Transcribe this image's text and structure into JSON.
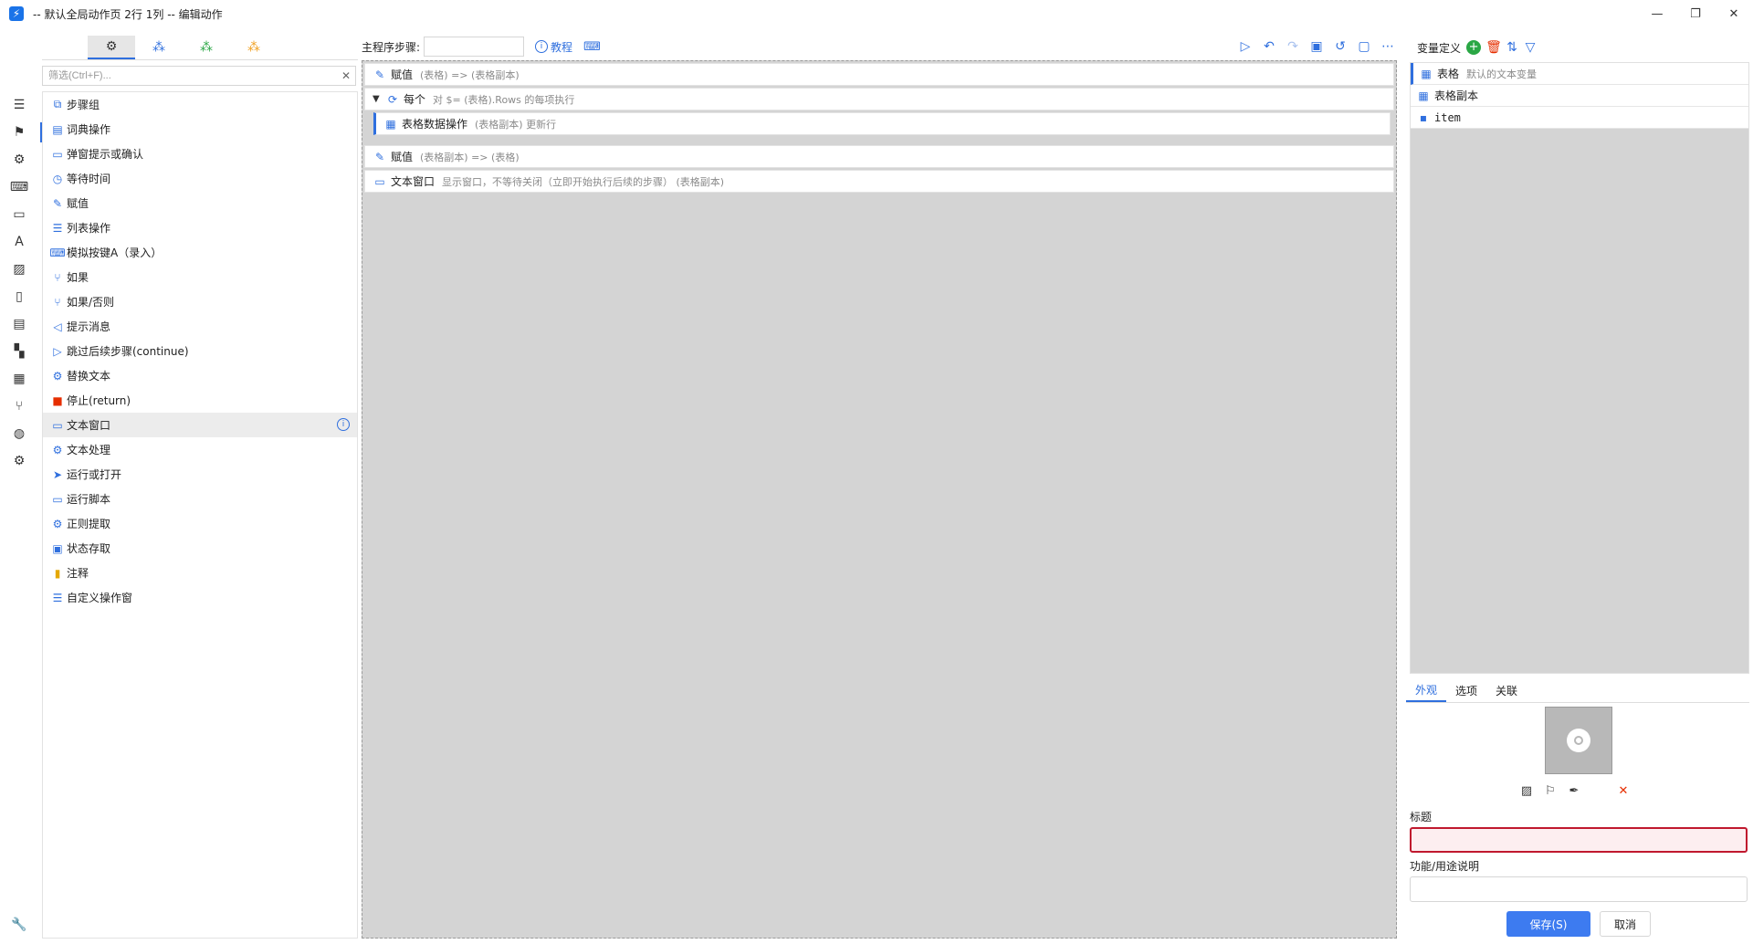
{
  "window": {
    "title": "-- 默认全局动作页 2行 1列 -- 编辑动作",
    "controls": {
      "minimize": "—",
      "restore": "❐",
      "close": "✕"
    }
  },
  "rail_icons": [
    "menu-icon",
    "bookmark-icon",
    "settings-icon",
    "keyboard-icon",
    "window-icon",
    "font-icon",
    "image-icon",
    "clipboard-icon",
    "document-icon",
    "windows-logo-icon",
    "table-icon",
    "git-branch-icon",
    "globe-icon",
    "gears-icon"
  ],
  "panel": {
    "filter_placeholder": "筛选(Ctrl+F)...",
    "actions": [
      {
        "label": "步骤组",
        "icon": "⧉",
        "tone": "blue"
      },
      {
        "label": "词典操作",
        "icon": "▤",
        "tone": "blue"
      },
      {
        "label": "弹窗提示或确认",
        "icon": "▭",
        "tone": "blue"
      },
      {
        "label": "等待时间",
        "icon": "◷",
        "tone": "blue"
      },
      {
        "label": "赋值",
        "icon": "✎",
        "tone": "blue"
      },
      {
        "label": "列表操作",
        "icon": "☰",
        "tone": "blue"
      },
      {
        "label": "模拟按键A（录入）",
        "icon": "⌨",
        "tone": "blue"
      },
      {
        "label": "如果",
        "icon": "⑂",
        "tone": "blue"
      },
      {
        "label": "如果/否则",
        "icon": "⑂",
        "tone": "blue"
      },
      {
        "label": "提示消息",
        "icon": "◁",
        "tone": "blue"
      },
      {
        "label": "跳过后续步骤(continue)",
        "icon": "▷",
        "tone": "blue"
      },
      {
        "label": "替换文本",
        "icon": "⚙",
        "tone": "blue"
      },
      {
        "label": "停止(return)",
        "icon": "■",
        "tone": "red"
      },
      {
        "label": "文本窗口",
        "icon": "▭",
        "tone": "blue"
      },
      {
        "label": "文本处理",
        "icon": "⚙",
        "tone": "blue"
      },
      {
        "label": "运行或打开",
        "icon": "➤",
        "tone": "blue"
      },
      {
        "label": "运行脚本",
        "icon": "▭",
        "tone": "blue"
      },
      {
        "label": "正则提取",
        "icon": "⚙",
        "tone": "blue"
      },
      {
        "label": "状态存取",
        "icon": "▣",
        "tone": "blue"
      },
      {
        "label": "注释",
        "icon": "▮",
        "tone": "yellow"
      },
      {
        "label": "自定义操作窗",
        "icon": "☰",
        "tone": "blue"
      }
    ]
  },
  "toolbar": {
    "steps_label": "主程序步骤:",
    "tutorial": "教程"
  },
  "steps": [
    {
      "name": "赋值",
      "desc": "(表格) => (表格副本)",
      "icon": "✎"
    },
    {
      "name": "每个",
      "desc": "对 $= (表格).Rows 的每项执行",
      "icon": "⟳"
    },
    {
      "name": "表格数据操作",
      "desc": "(表格副本) 更新行",
      "icon": "▦"
    },
    {
      "name": "赋值",
      "desc": "(表格副本) => (表格)",
      "icon": "✎"
    },
    {
      "name": "文本窗口",
      "desc": "显示窗口，不等待关闭（立即开始执行后续的步骤） (表格副本)",
      "icon": "▭"
    }
  ],
  "variables": {
    "header": "变量定义",
    "items": [
      {
        "name": "表格",
        "desc": "默认的文本变量",
        "icon": "▦"
      },
      {
        "name": "表格副本",
        "desc": "",
        "icon": "▦"
      },
      {
        "name": "item",
        "desc": "",
        "icon": "▪"
      }
    ]
  },
  "props": {
    "tabs": [
      "外观",
      "选项",
      "关联"
    ],
    "title_label": "标题",
    "title_value": "",
    "desc_label": "功能/用途说明",
    "desc_value": "",
    "save": "保存(S)",
    "cancel": "取消"
  },
  "colors": {
    "accent": "#2f6fde",
    "danger": "#e62e00",
    "canvas": "#d4d4d4",
    "save": "#3d7bf0"
  }
}
